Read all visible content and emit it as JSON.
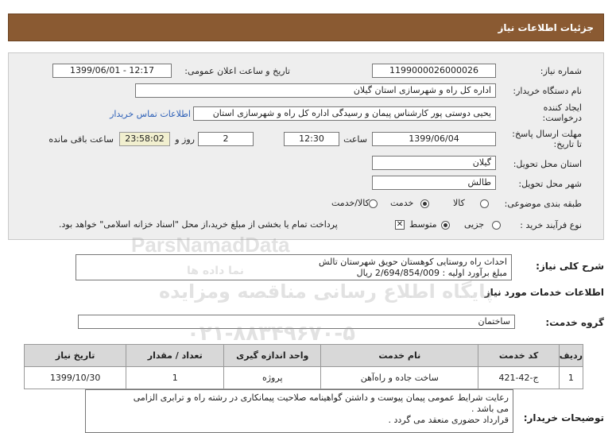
{
  "header": {
    "title": "جزئیات اطلاعات نیاز"
  },
  "fields": {
    "need_number_label": "شماره نیاز:",
    "need_number": "1199000026000026",
    "announce_label": "تاریخ و ساعت اعلان عمومی:",
    "announce_value": "1399/06/01 - 12:17",
    "buyer_label": "نام دستگاه خریدار:",
    "buyer_value": "اداره کل راه و شهرسازی استان گیلان",
    "creator_label_1": "ایجاد کننده",
    "creator_label_2": "درخواست:",
    "creator_value": "یحیی دوستی پور کارشناس پیمان و رسیدگی اداره کل راه و شهرسازی استان",
    "contact_link": "اطلاعات تماس خریدار",
    "deadline_label_1": "مهلت ارسال پاسخ:",
    "deadline_label_2": "تا تاریخ:",
    "deadline_date": "1399/06/04",
    "time_label": "ساعت",
    "deadline_time": "12:30",
    "days_value": "2",
    "days_label": "روز و",
    "remaining_timer": "23:58:02",
    "remaining_label": "ساعت باقی مانده",
    "province_label": "استان محل تحویل:",
    "province_value": "گیلان",
    "city_label": "شهر محل تحویل:",
    "city_value": "طالش",
    "category_label": "طبقه بندی موضوعی:",
    "category_options": [
      "کالا",
      "خدمت",
      "کالا/خدمت"
    ],
    "process_label": "نوع فرآیند خرید :",
    "process_options": [
      "جزیی",
      "متوسط"
    ],
    "payment_note": "پرداخت تمام یا بخشی از مبلغ خرید،از محل \"اسناد خزانه اسلامی\" خواهد بود."
  },
  "summary": {
    "label": "شرح کلی نیاز:",
    "line1": "احداث راه روستایی کوهستان حویق شهرستان تالش",
    "line2": "مبلغ برآورد اولیه : 2/694/854/009 ریال"
  },
  "services": {
    "section_title": "اطلاعات خدمات مورد نیاز",
    "group_label": "گروه خدمت:",
    "group_value": "ساختمان",
    "table": {
      "headers": [
        "ردیف",
        "کد خدمت",
        "نام خدمت",
        "واحد اندازه گیری",
        "تعداد / مقدار",
        "تاریخ نیاز"
      ],
      "rows": [
        [
          "1",
          "ج-42-421",
          "ساخت جاده و راه‌آهن",
          "پروژه",
          "1",
          "1399/10/30"
        ]
      ]
    }
  },
  "notes": {
    "label": "توضیحات خریدار:",
    "lines": [
      "رعایت شرایط عمومی پیمان پیوست و داشتن گواهینامه صلاحیت پیمانکاری در رشته راه و ترابری الزامی",
      "می باشد .",
      "قرارداد حضوری منعقد می گردد ."
    ]
  },
  "watermark": {
    "line1": "ParsNamadData",
    "line2": "پایگاه اطلاع رسانی مناقصه ومزایده",
    "line3": "۰۲۱-۸۸۳۴۹۶۷۰-۵",
    "line4": "نما داده ها"
  }
}
